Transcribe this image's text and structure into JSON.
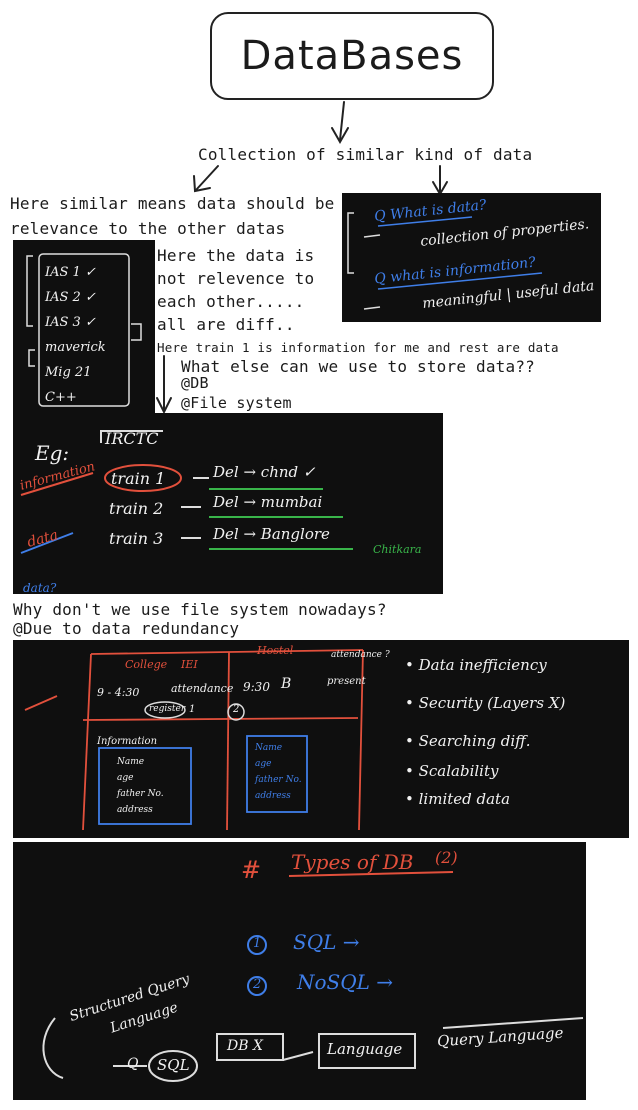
{
  "header": {
    "title": "DataBases"
  },
  "notes": {
    "collection": "Collection of similar kind of data",
    "similar_line1": "Here similar means data should be",
    "similar_line2": "relevance to the other datas",
    "not_rel_1": "Here the data is",
    "not_rel_2": "not relevence to",
    "not_rel_3": "each other.....",
    "not_rel_4": "all are diff..",
    "train_info": "Here train 1 is information for me and rest are data",
    "what_else": "What else can we use to store data??",
    "db": "@DB",
    "file_system": "@File system",
    "why_not": "Why don't we use file system nowadays?",
    "redundancy": "@Due to data redundancy"
  },
  "board_data": {
    "q1": "Q  What is data?",
    "a1": "collection of properties.",
    "q2": "Q  what is information?",
    "a2": "meaningful | useful data"
  },
  "board_list": {
    "items": [
      "IAS 1 ✓",
      "IAS 2 ✓",
      "IAS 3 ✓",
      "maverick",
      "Mig 21",
      "C++"
    ]
  },
  "board_irctc": {
    "eg": "Eg:",
    "brand": "IRCTC",
    "info_tag": "information",
    "data_tag": "data",
    "rows": [
      {
        "train": "train 1",
        "route": "Del → chnd ✓"
      },
      {
        "train": "train 2",
        "route": "Del → mumbai"
      },
      {
        "train": "train 3",
        "route": "Del → Banglore"
      }
    ],
    "watermark": "Chitkara",
    "partial": "data?"
  },
  "board_file": {
    "college": "College",
    "iei": "IEI",
    "hostel": "Hostel",
    "attendance_q": "attendance ?",
    "time1": "9 - 4:30",
    "attendance": "attendance",
    "time2": "9:30",
    "b": "B",
    "present": "present",
    "register": "register",
    "circ1": "1",
    "circ2": "2",
    "info_label": "Information",
    "fields_left": [
      "Name",
      "age",
      "father No.",
      "address"
    ],
    "fields_right": [
      "Name",
      "age",
      "father No.",
      "address"
    ],
    "bullets": [
      "Data inefficiency",
      "Security (Layers X)",
      "Searching diff.",
      "Scalability",
      "limited data"
    ]
  },
  "board_types": {
    "heading": "Types of DB",
    "count": "(2)",
    "hash": "#",
    "opt1_num": "1",
    "opt1": "SQL →",
    "opt2_num": "2",
    "opt2": "NoSQL →",
    "sql_full_1": "Structured Query",
    "sql_full_2": "Language",
    "q_label": "Q",
    "sql_circle": "SQL",
    "dbx": "DB X",
    "language": "Language",
    "query_language": "Query Language"
  }
}
